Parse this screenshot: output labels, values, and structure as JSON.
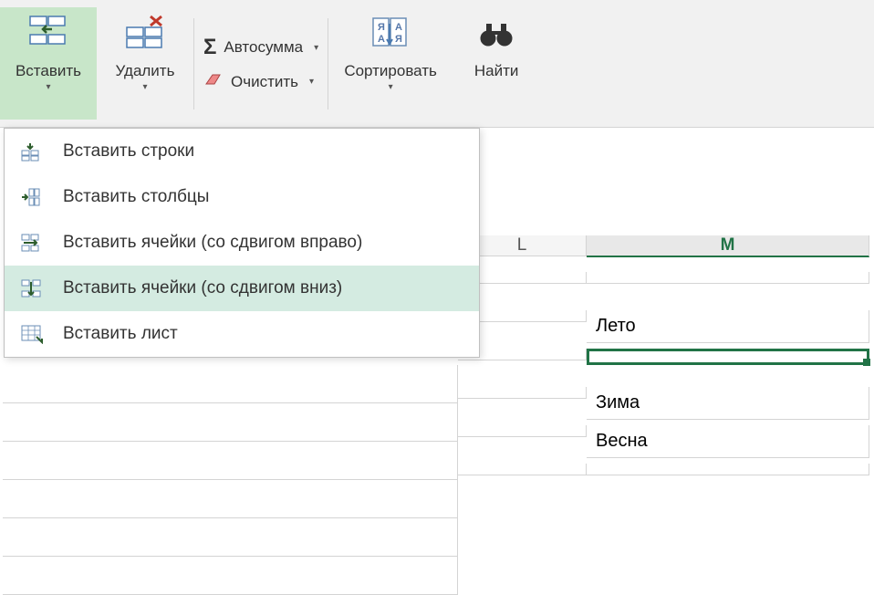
{
  "ribbon": {
    "insert": {
      "label": "Вставить"
    },
    "delete": {
      "label": "Удалить"
    },
    "autosum": {
      "label": "Автосумма"
    },
    "clear": {
      "label": "Очистить"
    },
    "sort": {
      "label": "Сортировать"
    },
    "find": {
      "label": "Найти"
    }
  },
  "menu": {
    "items": [
      {
        "label": "Вставить строки"
      },
      {
        "label": "Вставить столбцы"
      },
      {
        "label": "Вставить ячейки (со сдвигом вправо)"
      },
      {
        "label": "Вставить ячейки (со сдвигом вниз)"
      },
      {
        "label": "Вставить лист"
      }
    ]
  },
  "columns": {
    "L": "L",
    "M": "M"
  },
  "cells": {
    "m_values": [
      "",
      "Лето",
      "",
      "Зима",
      "Весна"
    ]
  }
}
